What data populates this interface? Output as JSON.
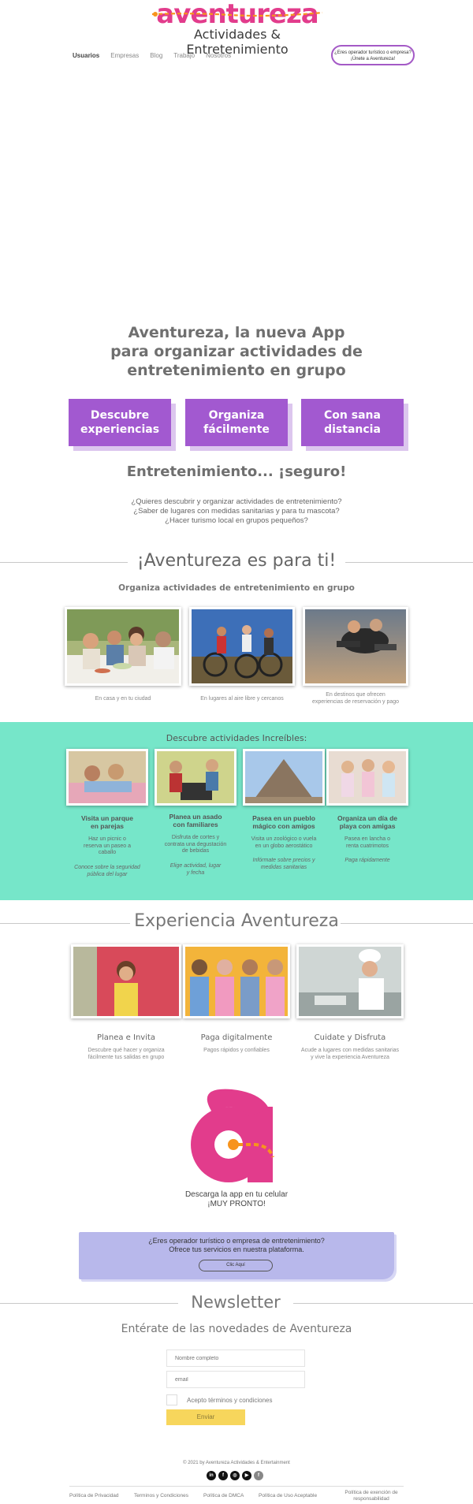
{
  "header": {
    "logo_word": "aventureza",
    "logo_sub": "Actividades & Entretenimiento",
    "nav": [
      "Usuarios",
      "Empresas",
      "Blog",
      "Trabajo",
      "Nosotros"
    ],
    "operator_btn_line1": "¿Eres operador turístico o empresa?",
    "operator_btn_line2": "¡Únete a Aventureza!"
  },
  "hero": {
    "title_line1": "Aventureza, la nueva App",
    "title_line2": "para organizar actividades de",
    "title_line3": "entretenimiento en grupo",
    "buttons": [
      {
        "line1": "Descubre",
        "line2": "experiencias"
      },
      {
        "line1": "Organiza",
        "line2": "fácilmente"
      },
      {
        "line1": "Con sana",
        "line2": "distancia"
      }
    ],
    "tagline": "Entretenimiento... ¡seguro!",
    "questions": [
      "¿Quieres descubrir y organizar actividades de entretenimiento?",
      "¿Saber de lugares con medidas sanitarias y para tu mascota?",
      "¿Hacer turismo local en grupos pequeños?"
    ]
  },
  "para_ti": {
    "title": "¡Aventureza es para ti!",
    "subtitle": "Organiza actividades de entretenimiento en grupo",
    "items": [
      {
        "caption1": "En casa y en tu ciudad",
        "caption2": ""
      },
      {
        "caption1": "En lugares al aire libre y cercanos",
        "caption2": ""
      },
      {
        "caption1": "En destinos que ofrecen",
        "caption2": "experiencias de reservación y pago"
      }
    ]
  },
  "actividades": {
    "title": "Descubre actividades Increíbles:",
    "items": [
      {
        "t1": "Visita un parque",
        "t2": "en parejas",
        "d1": "Haz un picnic o",
        "d2": "reserva un paseo a",
        "d3": "caballo",
        "l1": "Conoce sobre la seguridad",
        "l2": "pública del lugar"
      },
      {
        "t1": "Planea un asado",
        "t2": "con familiares",
        "d1": "Disfruta de cortes y",
        "d2": "contrata una degustación",
        "d3": "de bebidas",
        "l1": "Elige actividad, lugar",
        "l2": "y fecha"
      },
      {
        "t1": "Pasea en un pueblo",
        "t2": "mágico con amigos",
        "d1": "Visita un zoológico o vuela",
        "d2": "en un globo aerostático",
        "d3": "",
        "l1": "Infórmate sobre precios y",
        "l2": "medidas sanitarias"
      },
      {
        "t1": "Organiza un día de",
        "t2": "playa con amigas",
        "d1": "Pasea en lancha o",
        "d2": "renta cuatrimotos",
        "d3": "",
        "l1": "Paga rápidamente",
        "l2": ""
      }
    ]
  },
  "experiencia": {
    "title": "Experiencia Aventureza",
    "items": [
      {
        "title": "Planea e Invita",
        "d1": "Descubre qué hacer y organiza",
        "d2": "fácilmente tus salidas en grupo"
      },
      {
        "title": "Paga digitalmente",
        "d1": "Pagos rápidos y confiables",
        "d2": ""
      },
      {
        "title": "Cuidate y Disfruta",
        "d1": "Acude a lugares con medidas sanitarias",
        "d2": "y vive la experiencia Aventureza"
      }
    ]
  },
  "download": {
    "line1": "Descarga la app en tu celular",
    "line2": "¡MUY PRONTO!"
  },
  "cta": {
    "line1": "¿Eres operador turístico o empresa de entretenimiento?",
    "line2": "Ofrece tus servicios en nuestra plataforma.",
    "button": "Clic Aquí"
  },
  "newsletter": {
    "title": "Newsletter",
    "subtitle": "Entérate de las novedades de Aventureza",
    "name_placeholder": "Nombre completo",
    "email_placeholder": "email",
    "checkbox_label": "Acepto términos y condiciones",
    "send": "Enviar"
  },
  "footer": {
    "copyright": "© 2021 by Aventureza Actividades & Entertainment",
    "social": [
      "in",
      "f",
      "◎",
      "▶",
      "f"
    ],
    "links": [
      "Política de Privacidad",
      "Terminos y Condiciones",
      "Política de DMCA",
      "Política de Uso Aceptable",
      "Política de exención de responsabilidad"
    ]
  },
  "colors": {
    "brand_pink": "#e23c8c",
    "brand_orange": "#f7941d",
    "purple": "#a259d0",
    "teal": "#76e6c9",
    "lavender": "#b8b8eb",
    "yellow": "#f7d65c"
  }
}
